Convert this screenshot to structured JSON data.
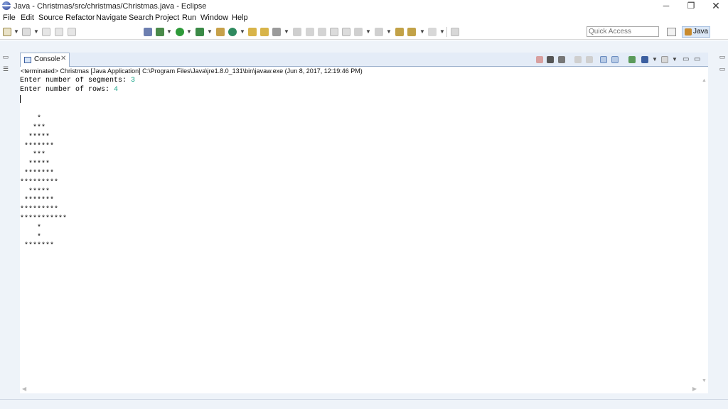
{
  "window": {
    "title": "Java - Christmas/src/christmas/Christmas.java - Eclipse",
    "minimize_glyph": "─",
    "maximize_glyph": "❐",
    "close_glyph": "✕"
  },
  "menu": [
    "File",
    "Edit",
    "Source",
    "Refactor",
    "Navigate",
    "Search",
    "Project",
    "Run",
    "Window",
    "Help"
  ],
  "toolbar": {
    "quick_access_placeholder": "Quick Access",
    "perspective_label": "Java"
  },
  "console": {
    "tab_label": "Console",
    "tab_close_glyph": "✕",
    "terminated_line": "<terminated> Christmas [Java Application] C:\\Program Files\\Java\\jre1.8.0_131\\bin\\javaw.exe (Jun 8, 2017, 12:19:46 PM)",
    "prompt_segments": "Enter number of segments: ",
    "value_segments": "3",
    "prompt_rows": "Enter number of rows: ",
    "value_rows": "4",
    "tree_output": "\n\n    *\n   ***\n  *****\n *******\n   ***\n  *****\n *******\n*********\n  *****\n *******\n*********\n***********\n    *\n    *\n *******"
  },
  "colors": {
    "input_text": "#1aa58a",
    "perspective_active": "#dbe7f6",
    "workbench_bg": "#eef3f9"
  },
  "icons": {
    "app": "eclipse-icon",
    "console_tab": "console-icon",
    "perspective": "java-perspective-icon"
  }
}
